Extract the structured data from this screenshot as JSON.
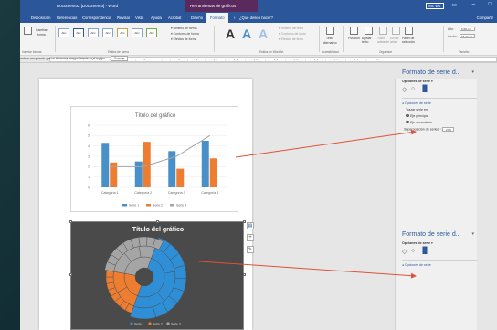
{
  "titlebar": {
    "doc_title": "Documento2 [Documento] - Word",
    "tools_title": "Herramientas de gráficos",
    "signin": "Inic. ses."
  },
  "tabs": [
    "Disposición",
    "Referencias",
    "Correspondencia",
    "Revisar",
    "Vista",
    "Ayuda",
    "Acrobat",
    "Diseño",
    "Formato"
  ],
  "tell_me": "¿Qué desea hacer?",
  "share": "Compartir",
  "ribbon": {
    "current_selection": [
      "Cambiar",
      "forma"
    ],
    "shape_styles": [
      "Abc",
      "Abc",
      "Abc",
      "Abc",
      "Abc",
      "Abc",
      "Abc"
    ],
    "shape_options": [
      "Relleno de forma",
      "Contorno de forma",
      "Efectos de forma"
    ],
    "wordart_letter": "A",
    "wordart_options": [
      "Relleno de texto",
      "Contorno de texto",
      "Efectos de texto"
    ],
    "alt_text": [
      "Texto",
      "alternativo"
    ],
    "arrange": [
      "Posición",
      "Ajustar texto",
      "Traer adelante",
      "Enviar atrás",
      "Panel de selección"
    ],
    "size": {
      "height_label": "Alto:",
      "height_value": "9,68 cm",
      "width_label": "Ancho:",
      "width_value": "15,24 cm"
    },
    "group_labels": [
      "Insertar formas",
      "Estilos de forma",
      "Estilos de WordArt",
      "Accesibilidad",
      "Organizar",
      "Tamaño"
    ]
  },
  "notice": {
    "text": "archivo recuperado que se almacena temporalmente en el equipo.",
    "button": "Guardar"
  },
  "ruler": "· 1 · | · 2 · | · 3 · | · 4 · | · 5 · | · 6 · | · 7 · | · 8 · | · 9 · | · 10 · | · 11 · | · 12 · | · 13 · | · 14 · | · 15 · | · 16 · | · 17 · | · 18 ·",
  "pane_top": {
    "title": "Formato de serie d...",
    "options_label": "Opciones de serie",
    "section": "Opciones de serie",
    "plot_on": "Trazar serie en",
    "primary": "Eje principal",
    "secondary": "Eje secundario",
    "overlap_label": "Superposición de series",
    "overlap_value": "27%"
  },
  "pane_bottom": {
    "title": "Formato de serie d...",
    "options_label": "Opciones de serie",
    "section": "Opciones de serie"
  },
  "chart_data": [
    {
      "type": "bar",
      "title": "Título del gráfico",
      "categories": [
        "Categoría 1",
        "Categoría 2",
        "Categoría 3",
        "Categoría 4"
      ],
      "series": [
        {
          "name": "Serie 1",
          "values": [
            4.3,
            2.5,
            3.5,
            4.5
          ],
          "color": "#4a90c8"
        },
        {
          "name": "Serie 2",
          "values": [
            2.4,
            4.4,
            1.8,
            2.8
          ],
          "color": "#ed7d31"
        }
      ],
      "line_series": {
        "name": "Serie 3",
        "values": [
          2,
          2,
          3,
          5
        ],
        "color": "#a5a5a5"
      },
      "ylim": [
        0,
        6
      ],
      "yticks": [
        "0",
        "1",
        "2",
        "3",
        "4",
        "5",
        "6"
      ],
      "legend": "bottom"
    },
    {
      "type": "sunburst",
      "title": "Título del gráfico",
      "background": "#4a4a4a",
      "series": [
        {
          "name": "Serie 1",
          "color": "#2e8fd6"
        },
        {
          "name": "Serie 2",
          "color": "#ed7d31"
        },
        {
          "name": "Serie 3",
          "color": "#a5a5a5"
        }
      ],
      "legend": "bottom"
    }
  ],
  "colors": {
    "accent": "#2b579a",
    "arrow": "#e0523a",
    "chart_tools": "#5a2a5e"
  }
}
